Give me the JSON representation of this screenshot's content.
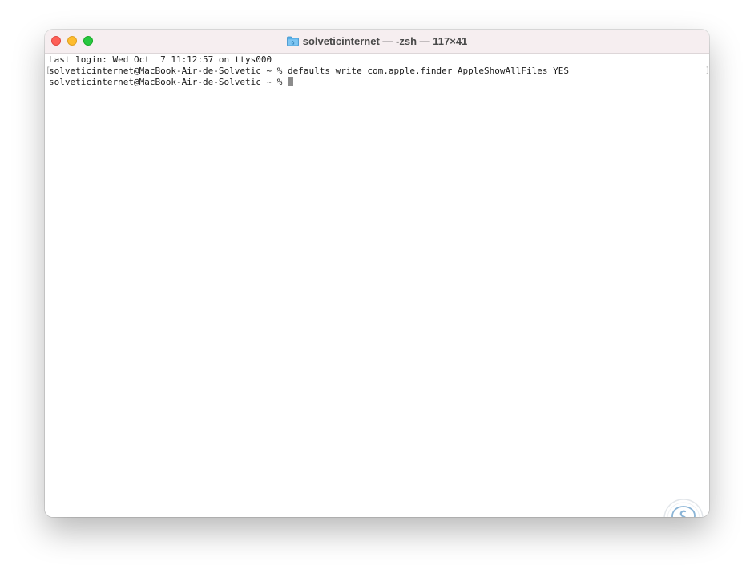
{
  "window": {
    "title": "solveticinternet — -zsh — 117×41"
  },
  "terminal": {
    "lines": [
      "Last login: Wed Oct  7 11:12:57 on ttys000",
      "solveticinternet@MacBook-Air-de-Solvetic ~ % defaults write com.apple.finder AppleShowAllFiles YES",
      "solveticinternet@MacBook-Air-de-Solvetic ~ % "
    ],
    "mark_left": "[",
    "mark_right": "]"
  },
  "icons": {
    "title_icon": "folder-icon",
    "watermark": "solvetic-logo-icon"
  },
  "colors": {
    "close": "#fe5f57",
    "minimize": "#febc2e",
    "zoom": "#28c840",
    "titlebar_bg": "#f6eef0",
    "cursor": "#8c8c8c"
  }
}
